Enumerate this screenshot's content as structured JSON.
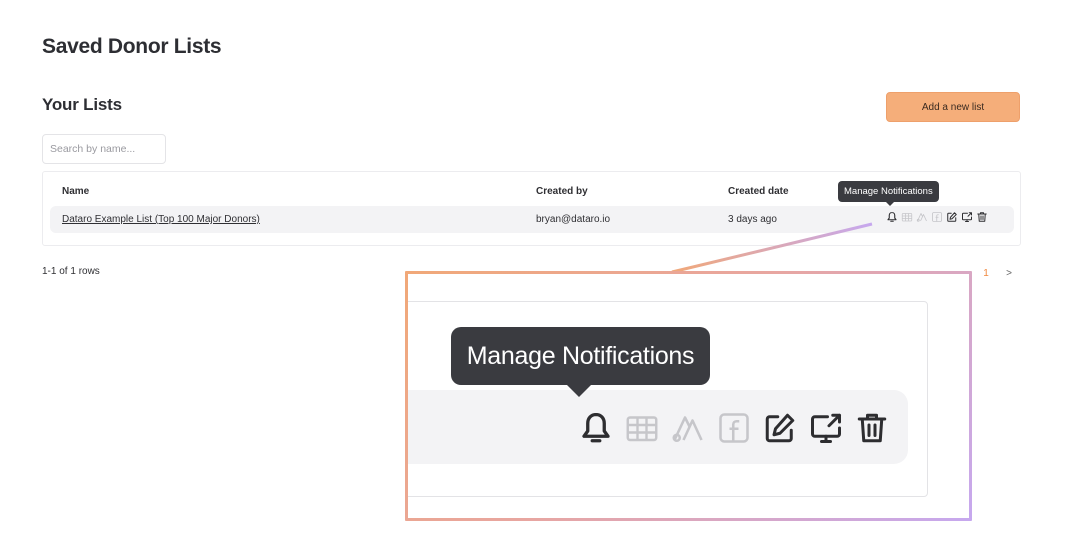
{
  "page": {
    "title": "Saved Donor Lists"
  },
  "section": {
    "title": "Your Lists"
  },
  "toolbar": {
    "add_label": "Add a new list"
  },
  "search": {
    "placeholder": "Search by name..."
  },
  "table": {
    "columns": [
      "Name",
      "Created by",
      "Created date"
    ],
    "rows": [
      {
        "name": "Dataro Example List (Top 100 Major Donors)",
        "created_by": "bryan@dataro.io",
        "created_date": "3 days ago"
      }
    ]
  },
  "tooltip": {
    "text": "Manage Notifications"
  },
  "row_actions": [
    "bell-icon",
    "table-grid-icon",
    "ads-logo-icon",
    "facebook-icon",
    "edit-icon",
    "export-screen-icon",
    "trash-icon"
  ],
  "pagination": {
    "info": "1-1 of 1 rows",
    "current_page": "1",
    "next_label": ">"
  },
  "zoom": {
    "tooltip": "Manage Notifications"
  },
  "colors": {
    "accent": "#f5ae7a",
    "page_active": "#f0883e",
    "tooltip_bg": "#3a3b40",
    "frame_start": "#f1a878",
    "frame_end": "#c6a8ef"
  }
}
